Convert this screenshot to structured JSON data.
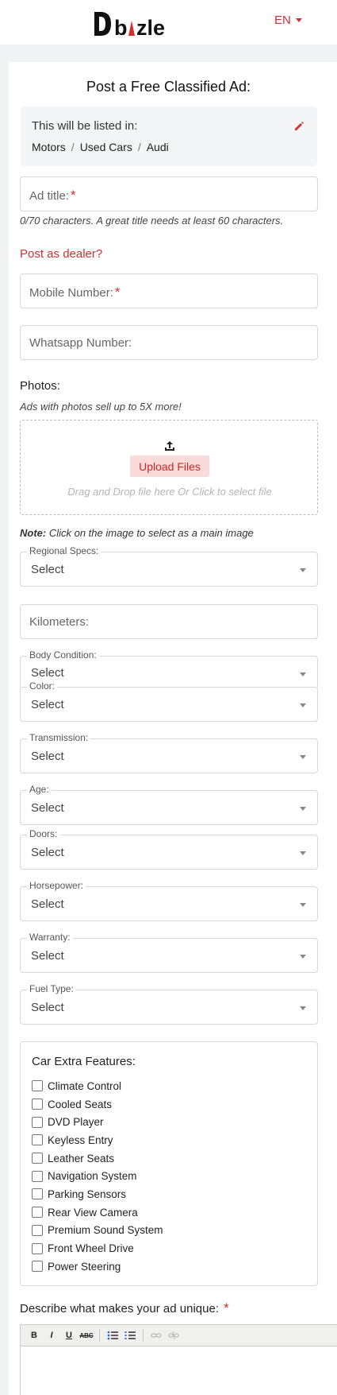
{
  "header": {
    "logo_text": "Dbizle",
    "language": "EN"
  },
  "form": {
    "title": "Post a Free Classified Ad:",
    "listed_in": {
      "label": "This will be listed in:",
      "crumbs": [
        "Motors",
        "Used Cars",
        "Audi"
      ]
    },
    "ad_title": {
      "placeholder": "Ad title:",
      "required": "*"
    },
    "ad_title_hint": "0/70 characters. A great title needs at least 60 characters.",
    "post_as_dealer": "Post as dealer?",
    "mobile": {
      "placeholder": "Mobile Number:",
      "required": "*"
    },
    "whatsapp": {
      "placeholder": "Whatsapp Number:"
    },
    "photos": {
      "label": "Photos:",
      "hint": "Ads with photos sell up to 5X more!",
      "upload_button": "Upload Files",
      "drop_text": "Drag and Drop file here Or Click to select file",
      "note_bold": "Note:",
      "note_text": " Click on the image to select as a main image"
    },
    "kilometers": {
      "placeholder": "Kilometers:"
    },
    "selects": {
      "regional_specs": {
        "label": "Regional Specs:",
        "value": "Select"
      },
      "body_condition": {
        "label": "Body Condition:",
        "value": "Select"
      },
      "color": {
        "label": "Color:",
        "value": "Select"
      },
      "transmission": {
        "label": "Transmission:",
        "value": "Select"
      },
      "age": {
        "label": "Age:",
        "value": "Select"
      },
      "doors": {
        "label": "Doors:",
        "value": "Select"
      },
      "horsepower": {
        "label": "Horsepower:",
        "value": "Select"
      },
      "warranty": {
        "label": "Warranty:",
        "value": "Select"
      },
      "fuel_type": {
        "label": "Fuel Type:",
        "value": "Select"
      }
    },
    "features": {
      "title": "Car Extra Features:",
      "items": [
        "Climate Control",
        "Cooled Seats",
        "DVD Player",
        "Keyless Entry",
        "Leather Seats",
        "Navigation System",
        "Parking Sensors",
        "Rear View Camera",
        "Premium Sound System",
        "Front Wheel Drive",
        "Power Steering"
      ]
    },
    "description": {
      "label": "Describe what makes your ad unique:",
      "required": "*",
      "toolbar": [
        "B",
        "I",
        "U",
        "ABC"
      ]
    }
  },
  "colors": {
    "accent": "#d32f2f",
    "upload_bg": "#fbdada",
    "page_bg": "#f1f2f4"
  }
}
